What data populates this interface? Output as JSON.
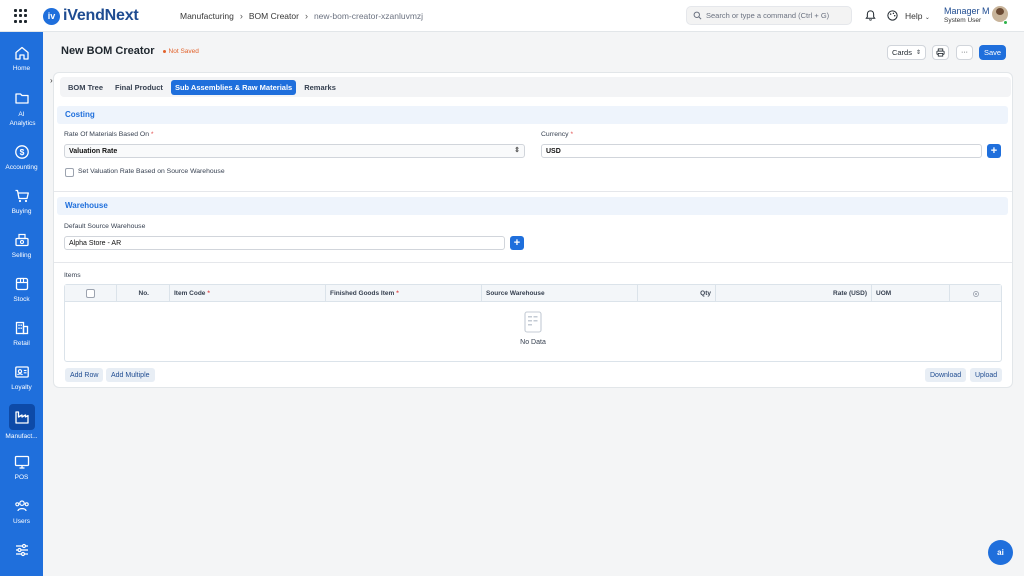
{
  "app": {
    "name": "iVendNext",
    "logo_letter": "iv"
  },
  "breadcrumb": {
    "items": [
      "Manufacturing",
      "BOM Creator",
      "new-bom-creator-xzanluvmzj"
    ]
  },
  "search": {
    "placeholder": "Search or type a command (Ctrl + G)"
  },
  "header": {
    "help_label": "Help",
    "user_name": "Manager M",
    "user_role": "System User"
  },
  "sidebar": {
    "items": [
      {
        "label": "Home",
        "icon": "home-icon"
      },
      {
        "label": "AI Analytics",
        "icon": "folder-icon"
      },
      {
        "label": "Accounting",
        "icon": "dollar-icon"
      },
      {
        "label": "Buying",
        "icon": "cart-icon"
      },
      {
        "label": "Selling",
        "icon": "register-icon"
      },
      {
        "label": "Stock",
        "icon": "box-icon"
      },
      {
        "label": "Retail",
        "icon": "building-icon"
      },
      {
        "label": "Loyalty",
        "icon": "id-card-icon"
      },
      {
        "label": "Manufact...",
        "icon": "factory-icon",
        "active": true
      },
      {
        "label": "POS",
        "icon": "monitor-icon"
      },
      {
        "label": "Users",
        "icon": "users-icon"
      },
      {
        "label": "",
        "icon": "sliders-icon"
      }
    ]
  },
  "page": {
    "title": "New BOM Creator",
    "status": "Not Saved",
    "cards_label": "Cards",
    "more_label": "···",
    "save_label": "Save"
  },
  "tabs": [
    "BOM Tree",
    "Final Product",
    "Sub Assemblies & Raw Materials",
    "Remarks"
  ],
  "costing": {
    "title": "Costing",
    "rate_label": "Rate Of Materials Based On",
    "rate_value": "Valuation Rate",
    "currency_label": "Currency",
    "currency_value": "USD",
    "checkbox_label": "Set Valuation Rate Based on Source Warehouse"
  },
  "warehouse": {
    "title": "Warehouse",
    "source_label": "Default Source Warehouse",
    "source_value": "Alpha Store - AR"
  },
  "items": {
    "label": "Items",
    "columns": [
      "No.",
      "Item Code",
      "Finished Goods Item",
      "Source Warehouse",
      "Qty",
      "Rate (USD)",
      "UOM"
    ],
    "empty_text": "No Data",
    "add_row_label": "Add Row",
    "add_multiple_label": "Add Multiple",
    "download_label": "Download",
    "upload_label": "Upload"
  },
  "ai_bubble_label": "ai",
  "colors": {
    "primary": "#1f6fdc",
    "sidebar_active": "#0d4aa8",
    "status": "#e2622b"
  }
}
